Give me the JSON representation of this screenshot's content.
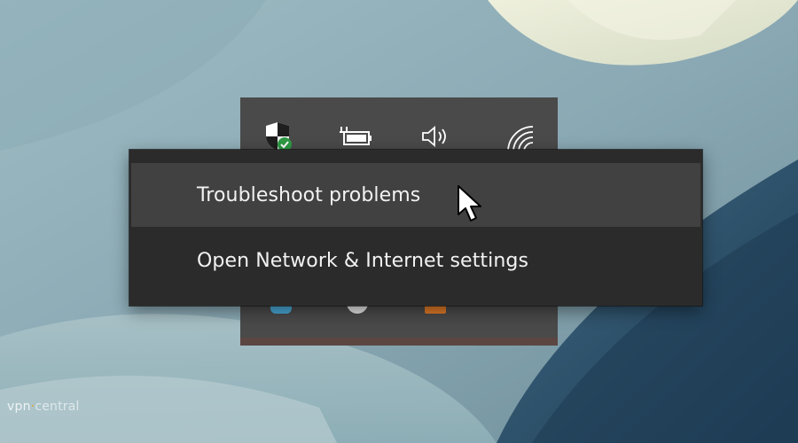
{
  "context_menu": {
    "items": [
      {
        "label": "Troubleshoot problems",
        "state": "hovered"
      },
      {
        "label": "Open Network & Internet settings",
        "state": "normal"
      }
    ]
  },
  "tray": {
    "icons": [
      "defender-shield-icon",
      "battery-charging-icon",
      "speaker-volume-icon",
      "wifi-icon"
    ]
  },
  "watermark": {
    "text": "vpncentral",
    "prefix": "vpn",
    "suffix": "central"
  },
  "colors": {
    "menu_bg": "#2b2b2b",
    "menu_hover": "#414141",
    "tray_bg": "#4a4a4a",
    "defender_green": "#2e9a44",
    "watermark_accent": "#e8a317"
  }
}
